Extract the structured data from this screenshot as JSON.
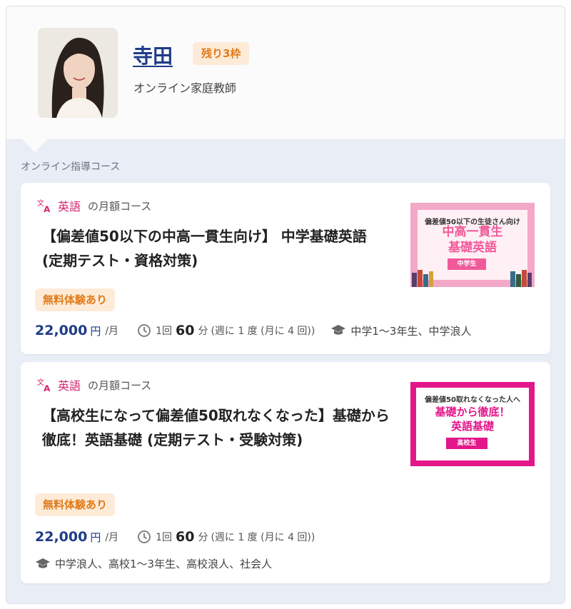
{
  "tutor": {
    "name": "寺田",
    "slots_badge": "残り3枠",
    "role": "オンライン家庭教師"
  },
  "section_label": "オンライン指導コース",
  "courses": [
    {
      "subject": "英語",
      "course_type": "の月額コース",
      "title": "【偏差値50以下の中高一貫生向け】 中学基礎英語 (定期テスト・資格対策)",
      "trial_badge": "無料体験あり",
      "price": "22,000",
      "price_unit": "円",
      "per": "/月",
      "lesson_count": "1回",
      "lesson_minutes": "60",
      "lesson_unit": "分",
      "lesson_freq": "(週に 1 度 (月に 4 回))",
      "target": "中学1〜3年生、中学浪人",
      "thumbnail": {
        "subtitle": "偏差値50以下の生徒さん向け",
        "main_line1": "中高一貫生",
        "main_line2": "基礎英語",
        "tag": "中学生"
      }
    },
    {
      "subject": "英語",
      "course_type": "の月額コース",
      "title": "【高校生になって偏差値50取れなくなった】基礎から徹底！英語基礎 (定期テスト・受験対策)",
      "trial_badge": "無料体験あり",
      "price": "22,000",
      "price_unit": "円",
      "per": "/月",
      "lesson_count": "1回",
      "lesson_minutes": "60",
      "lesson_unit": "分",
      "lesson_freq": "(週に 1 度 (月に 4 回))",
      "target": "中学浪人、高校1〜3年生、高校浪人、社会人",
      "thumbnail": {
        "subtitle": "偏差値50取れなくなった人へ",
        "main_line1": "基礎から徹底！",
        "main_line2": "英語基礎",
        "tag": "高校生"
      }
    }
  ],
  "colors": {
    "name_link": "#1f3c88",
    "price": "#1f3c88",
    "subject": "#d6246e",
    "badge_bg": "#fdebd8",
    "badge_text": "#e07b1a",
    "section_bg": "#e9edf5"
  },
  "icons": {
    "subject": "translate-icon",
    "duration": "clock-icon",
    "target": "graduation-cap-icon"
  }
}
